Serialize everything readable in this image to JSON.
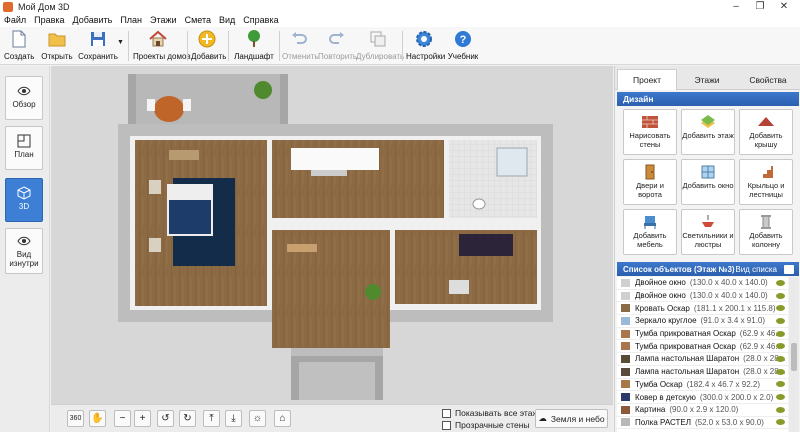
{
  "window": {
    "title": "Мой Дом 3D"
  },
  "menu": [
    "Файл",
    "Правка",
    "Добавить",
    "План",
    "Этажи",
    "Смета",
    "Вид",
    "Справка"
  ],
  "toolbar": {
    "create": "Создать",
    "open": "Открыть",
    "save": "Сохранить",
    "house_projects": "Проекты домов",
    "add": "Добавить",
    "landscape": "Ландшафт",
    "undo": "Отменить",
    "redo": "Повторить",
    "duplicate": "Дублировать",
    "settings": "Настройки",
    "tutorial": "Учебник"
  },
  "leftnav": {
    "overview": "Обзор",
    "plan": "План",
    "view3d": "3D",
    "inside": "Вид изнутри"
  },
  "bottombar": {
    "show_all_floors": "Показывать все этажи",
    "transparent_walls": "Прозрачные стены",
    "ground_sky": "Земля и небо"
  },
  "tabs": [
    "Проект",
    "Этажи",
    "Свойства"
  ],
  "design": {
    "header": "Дизайн",
    "buttons": [
      "Нарисовать стены",
      "Добавить этаж",
      "Добавить крышу",
      "Двери и ворота",
      "Добавить окно",
      "Крыльцо и лестницы",
      "Добавить мебель",
      "Светильники и люстры",
      "Добавить колонну"
    ]
  },
  "objects": {
    "header": "Список объектов (Этаж №3)",
    "view_list": "Вид списка",
    "items": [
      {
        "name": "Двойное окно",
        "dims": "(130.0 x 40.0 x 140.0)"
      },
      {
        "name": "Двойное окно",
        "dims": "(130.0 x 40.0 x 140.0)"
      },
      {
        "name": "Кровать Оскар",
        "dims": "(181.1 x 200.1 x 115.8)"
      },
      {
        "name": "Зеркало круглое",
        "dims": "(91.0 x 3.4 x 91.0)"
      },
      {
        "name": "Тумба прикроватная Оскар",
        "dims": "(62.9 x 46..."
      },
      {
        "name": "Тумба прикроватная Оскар",
        "dims": "(62.9 x 46..."
      },
      {
        "name": "Лампа настольная Шаратон",
        "dims": "(28.0 x 28..."
      },
      {
        "name": "Лампа настольная Шаратон",
        "dims": "(28.0 x 28..."
      },
      {
        "name": "Тумба Оскар",
        "dims": "(182.4 x 46.7 x 92.2)"
      },
      {
        "name": "Ковер в детскую",
        "dims": "(300.0 x 200.0 x 2.0)"
      },
      {
        "name": "Картина",
        "dims": "(90.0 x 2.9 x 120.0)"
      },
      {
        "name": "Полка РАСТЕЛ",
        "dims": "(52.0 x 53.0 x 90.0)"
      }
    ]
  },
  "colors": {
    "accent": "#3c7fd5",
    "header": "#2b5fae",
    "floor": "#8c6a44",
    "wall": "#f2f2f2"
  }
}
